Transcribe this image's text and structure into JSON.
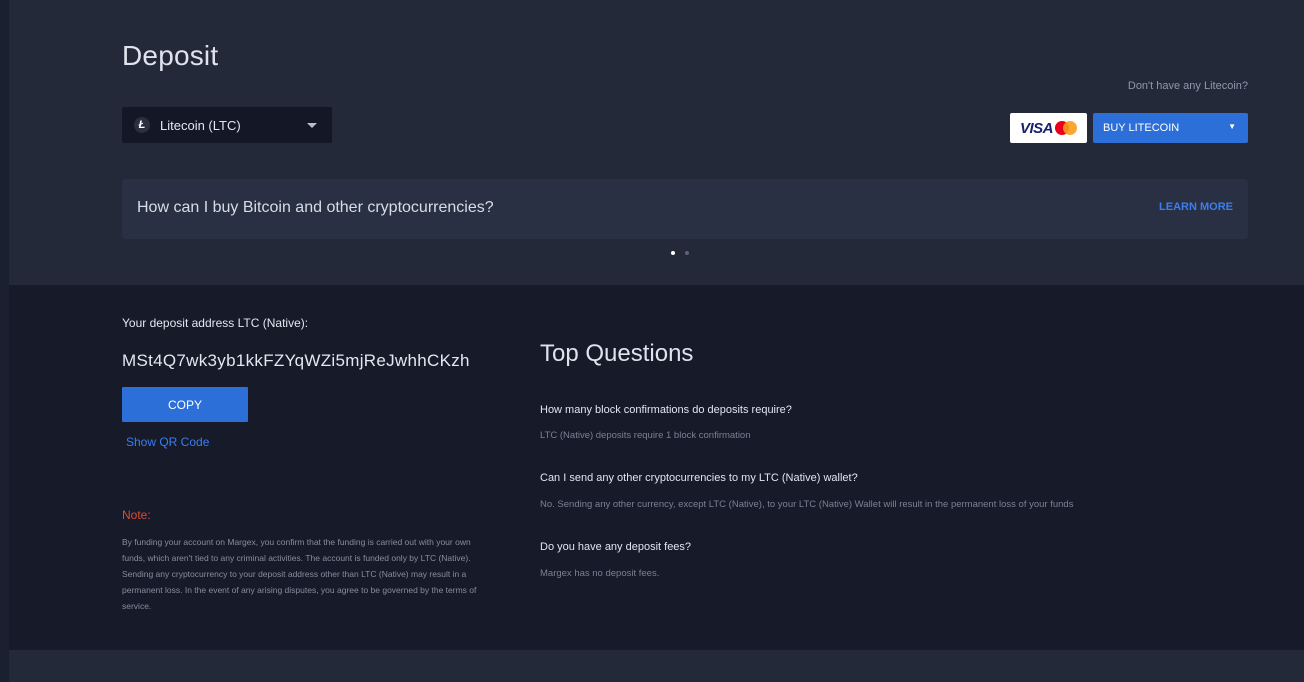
{
  "page": {
    "title": "Deposit"
  },
  "currency_select": {
    "icon_glyph": "Ł",
    "label": "Litecoin (LTC)"
  },
  "buy_panel": {
    "no_ltc_text": "Don't have any Litecoin?",
    "visa_text": "VISA",
    "buy_button_label": "BUY LITECOIN",
    "buy_caret": "▼"
  },
  "banner": {
    "text": "How can I buy Bitcoin and other cryptocurrencies?",
    "learn_more_label": "LEARN MORE"
  },
  "carousel": {
    "total": 2,
    "active": 1
  },
  "deposit": {
    "label": "Your deposit address LTC (Native):",
    "address": "MSt4Q7wk3yb1kkFZYqWZi5mjReJwhhCKzh",
    "copy_label": "COPY",
    "qr_link_label": "Show QR Code"
  },
  "note": {
    "label": "Note:",
    "text": "By funding your account on Margex, you confirm that the funding is carried out with your own funds, which aren't tied to any criminal activities. The account is funded only by LTC (Native). Sending any cryptocurrency to your deposit address other than LTC (Native) may result in a permanent loss. In the event of any arising disputes, you agree to be governed by the terms of service."
  },
  "questions": {
    "title": "Top Questions",
    "items": [
      {
        "question": "How many block confirmations do deposits require?",
        "answer": "LTC (Native) deposits require 1 block confirmation"
      },
      {
        "question": "Can I send any other cryptocurrencies to my LTC (Native) wallet?",
        "answer": "No. Sending any other currency, except LTC (Native), to your LTC (Native) Wallet will result in the permanent loss of your funds"
      },
      {
        "question": "Do you have any deposit fees?",
        "answer": "Margex has no deposit fees."
      }
    ]
  },
  "colors": {
    "accent": "#2d6fd8",
    "link": "#3a7ef0",
    "note": "#e0492f",
    "background_top": "#232939",
    "background_bottom": "#161a29"
  }
}
